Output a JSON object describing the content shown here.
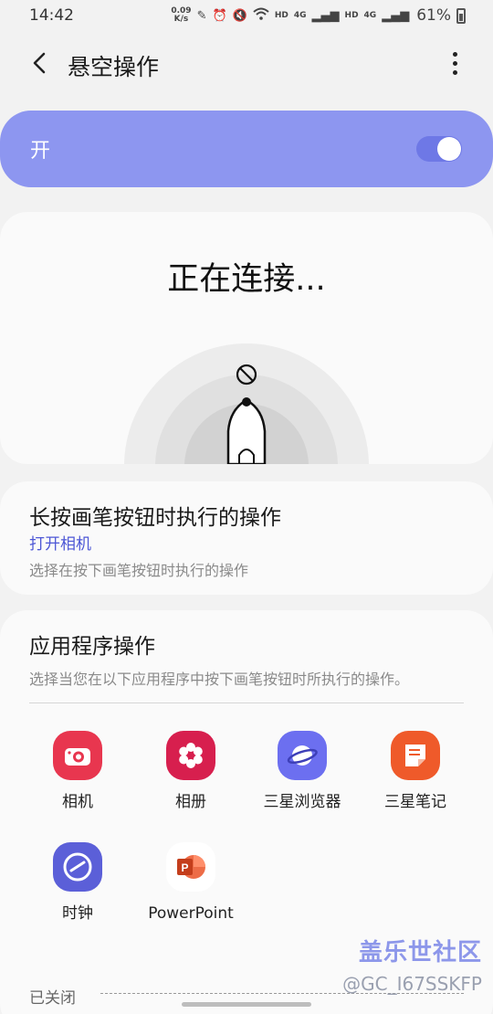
{
  "status": {
    "time": "14:42",
    "speed_value": "0.09",
    "speed_unit": "K/s",
    "net1": "HD",
    "net1_gen": "4G",
    "net2": "HD",
    "net2_gen": "4G",
    "battery": "61%"
  },
  "header": {
    "title": "悬空操作"
  },
  "master": {
    "label": "开",
    "enabled": true,
    "accent": "#8d96f0"
  },
  "connect": {
    "title": "正在连接..."
  },
  "press_action": {
    "title": "长按画笔按钮时执行的操作",
    "value": "打开相机",
    "desc": "选择在按下画笔按钮时执行的操作"
  },
  "app_actions": {
    "title": "应用程序操作",
    "desc": "选择当您在以下应用程序中按下画笔按钮时所执行的操作。",
    "apps": [
      {
        "label": "相机",
        "icon": "camera-icon",
        "color": "#e8364f"
      },
      {
        "label": "相册",
        "icon": "gallery-icon",
        "color": "#d71f4e"
      },
      {
        "label": "三星浏览器",
        "icon": "browser-icon",
        "color": "#6c6ff0"
      },
      {
        "label": "三星笔记",
        "icon": "notes-icon",
        "color": "#ef5a2a"
      },
      {
        "label": "时钟",
        "icon": "clock-icon",
        "color": "#5b5fd8"
      },
      {
        "label": "PowerPoint",
        "icon": "powerpoint-icon",
        "color": "#d24726"
      }
    ],
    "closed_label": "已关闭"
  },
  "watermark": {
    "brand": "盖乐世社区",
    "user": "@GC_I67SSKFP"
  }
}
